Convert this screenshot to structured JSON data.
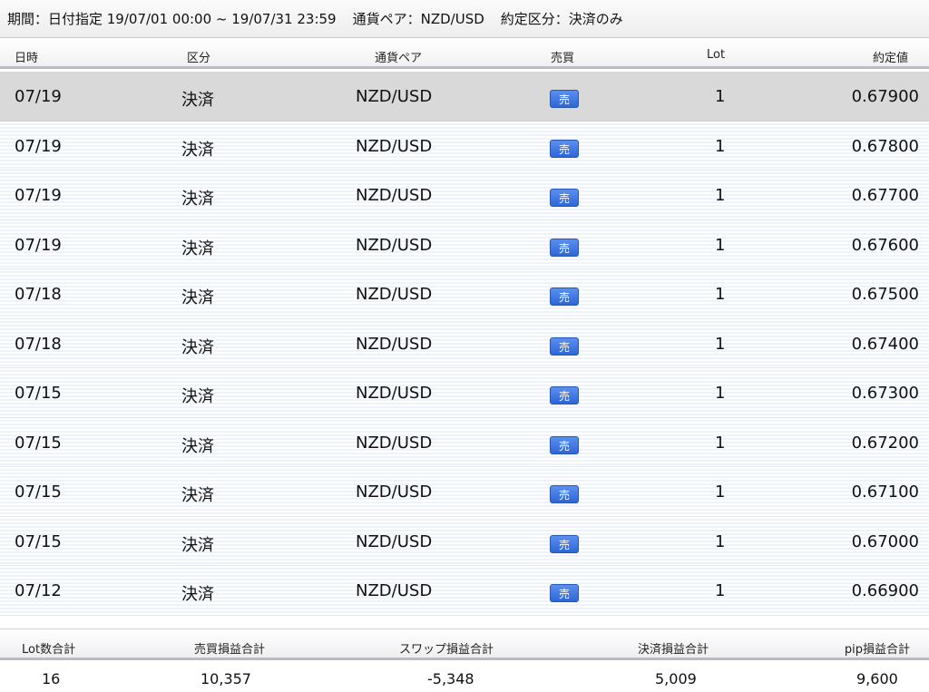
{
  "filter": {
    "period": "期間：日付指定 19/07/01 00:00 ~ 19/07/31 23:59",
    "pair": "通貨ペア：NZD/USD",
    "type": "約定区分：決済のみ"
  },
  "columns": {
    "date": "日時",
    "kubun": "区分",
    "pair": "通貨ペア",
    "side": "売買",
    "lot": "Lot",
    "price": "約定値"
  },
  "rows": [
    {
      "date": "07/19",
      "kubun": "決済",
      "pair": "NZD/USD",
      "side": "売",
      "lot": "1",
      "price": "0.67900"
    },
    {
      "date": "07/19",
      "kubun": "決済",
      "pair": "NZD/USD",
      "side": "売",
      "lot": "1",
      "price": "0.67800"
    },
    {
      "date": "07/19",
      "kubun": "決済",
      "pair": "NZD/USD",
      "side": "売",
      "lot": "1",
      "price": "0.67700"
    },
    {
      "date": "07/19",
      "kubun": "決済",
      "pair": "NZD/USD",
      "side": "売",
      "lot": "1",
      "price": "0.67600"
    },
    {
      "date": "07/18",
      "kubun": "決済",
      "pair": "NZD/USD",
      "side": "売",
      "lot": "1",
      "price": "0.67500"
    },
    {
      "date": "07/18",
      "kubun": "決済",
      "pair": "NZD/USD",
      "side": "売",
      "lot": "1",
      "price": "0.67400"
    },
    {
      "date": "07/15",
      "kubun": "決済",
      "pair": "NZD/USD",
      "side": "売",
      "lot": "1",
      "price": "0.67300"
    },
    {
      "date": "07/15",
      "kubun": "決済",
      "pair": "NZD/USD",
      "side": "売",
      "lot": "1",
      "price": "0.67200"
    },
    {
      "date": "07/15",
      "kubun": "決済",
      "pair": "NZD/USD",
      "side": "売",
      "lot": "1",
      "price": "0.67100"
    },
    {
      "date": "07/15",
      "kubun": "決済",
      "pair": "NZD/USD",
      "side": "売",
      "lot": "1",
      "price": "0.67000"
    },
    {
      "date": "07/12",
      "kubun": "決済",
      "pair": "NZD/USD",
      "side": "売",
      "lot": "1",
      "price": "0.66900"
    }
  ],
  "summary": {
    "labels": {
      "lot_total": "Lot数合計",
      "trade_pl": "売買損益合計",
      "swap_pl": "スワップ損益合計",
      "settle_pl": "決済損益合計",
      "pip_pl": "pip損益合計"
    },
    "values": {
      "lot_total": "16",
      "trade_pl": "10,357",
      "swap_pl": "-5,348",
      "settle_pl": "5,009",
      "pip_pl": "9,600"
    }
  },
  "colors": {
    "sell_badge": "#2f66d6",
    "selected_row": "#d9d9d9",
    "row_stripe": "#eef3fb"
  }
}
